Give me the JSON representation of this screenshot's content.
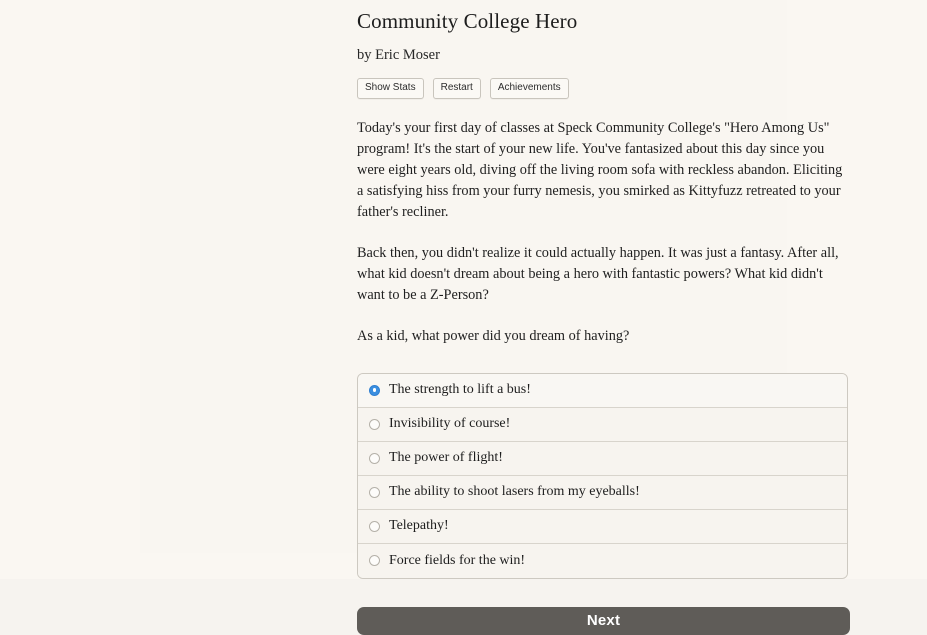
{
  "story": {
    "title": "Community College Hero",
    "byline": "by Eric Moser"
  },
  "toolbar": {
    "show_stats_label": "Show Stats",
    "restart_label": "Restart",
    "achievements_label": "Achievements"
  },
  "passage": {
    "paragraph_1": "Today's your first day of classes at Speck Community College's \"Hero Among Us\" program! It's the start of your new life. You've fantasized about this day since you were eight years old, diving off the living room sofa with reckless abandon. Eliciting a satisfying hiss from your furry nemesis, you smirked as Kittyfuzz retreated to your father's recliner.",
    "paragraph_2": "Back then, you didn't realize it could actually happen. It was just a fantasy. After all, what kid doesn't dream about being a hero with fantastic powers? What kid didn't want to be a Z-Person?",
    "question": "As a kid, what power did you dream of having?"
  },
  "choices": [
    {
      "label": "The strength to lift a bus!",
      "selected": true
    },
    {
      "label": "Invisibility of course!",
      "selected": false
    },
    {
      "label": "The power of flight!",
      "selected": false
    },
    {
      "label": "The ability to shoot lasers from my eyeballs!",
      "selected": false
    },
    {
      "label": "Telepathy!",
      "selected": false
    },
    {
      "label": "Force fields for the win!",
      "selected": false
    }
  ],
  "actions": {
    "next_label": "Next"
  },
  "colors": {
    "page_background": "#faf7f2",
    "panel_background": "#f9f6f1",
    "options_background": "#f7f4ef",
    "options_border": "#cdc9c1",
    "radio_selected": "#3b8fe0",
    "next_button": "#5f5c58",
    "text": "#1d1d1d"
  }
}
